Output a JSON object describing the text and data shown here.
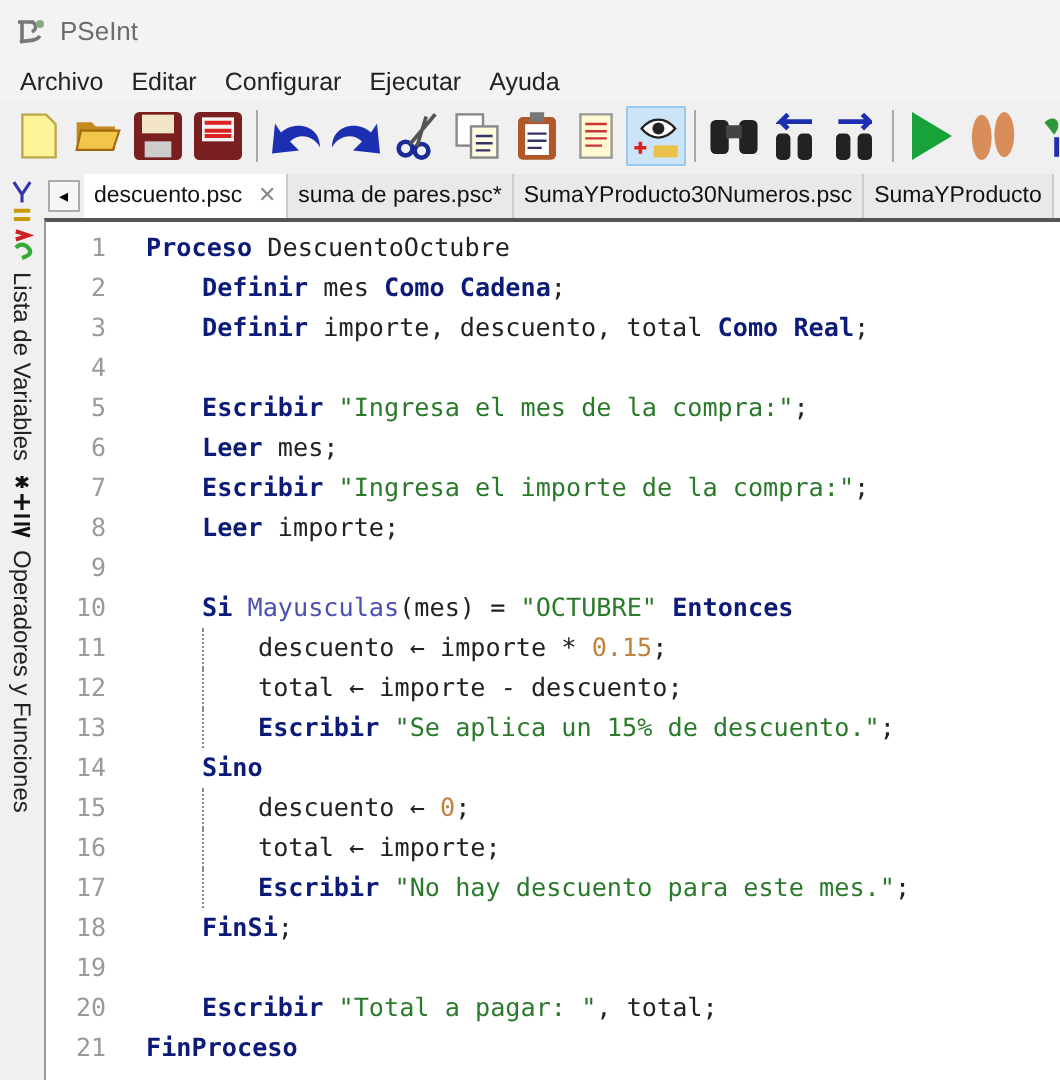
{
  "window": {
    "title": "PSeInt"
  },
  "menu": [
    "Archivo",
    "Editar",
    "Configurar",
    "Ejecutar",
    "Ayuda"
  ],
  "toolbar": [
    [
      {
        "kind": "new"
      },
      {
        "kind": "open"
      },
      {
        "kind": "save"
      },
      {
        "kind": "saveas"
      }
    ],
    [
      {
        "kind": "undo"
      },
      {
        "kind": "redo"
      },
      {
        "kind": "cut"
      },
      {
        "kind": "copy"
      },
      {
        "kind": "paste"
      },
      {
        "kind": "doc"
      },
      {
        "kind": "eye",
        "pressed": true
      }
    ],
    [
      {
        "kind": "find"
      },
      {
        "kind": "findprev"
      },
      {
        "kind": "findnext"
      }
    ],
    [
      {
        "kind": "run"
      },
      {
        "kind": "steps"
      },
      {
        "kind": "flow"
      }
    ]
  ],
  "tab_scroll": "◂",
  "tabs": [
    {
      "label": "descuento.psc",
      "selected": true,
      "close": "✕"
    },
    {
      "label": "suma de pares.psc*",
      "selected": false
    },
    {
      "label": "SumaYProducto30Numeros.psc",
      "selected": false
    },
    {
      "label": "SumaYProducto",
      "selected": false
    }
  ],
  "side_panels": [
    {
      "label": "Lista de Variables",
      "kind": "vars"
    },
    {
      "label": "Operadores y Funciones",
      "kind": "ops"
    }
  ],
  "code": [
    {
      "number": "1",
      "tokens": [
        {
          "kind": "kw",
          "text": "Proceso"
        },
        {
          "kind": "id",
          "text": " DescuentoOctubre"
        }
      ],
      "children": [
        {
          "number": "2",
          "tokens": [
            {
              "kind": "kw",
              "text": "Definir"
            },
            {
              "kind": "id",
              "text": " mes "
            },
            {
              "kind": "kw",
              "text": "Como Cadena"
            },
            {
              "kind": "id",
              "text": ";"
            }
          ]
        },
        {
          "number": "3",
          "tokens": [
            {
              "kind": "kw",
              "text": "Definir"
            },
            {
              "kind": "id",
              "text": " importe, descuento, total "
            },
            {
              "kind": "kw",
              "text": "Como Real"
            },
            {
              "kind": "id",
              "text": ";"
            }
          ]
        },
        {
          "number": "4"
        },
        {
          "number": "5",
          "tokens": [
            {
              "kind": "kw",
              "text": "Escribir"
            },
            {
              "kind": "str",
              "text": " \"Ingresa el mes de la compra:\""
            },
            {
              "kind": "id",
              "text": ";"
            }
          ]
        },
        {
          "number": "6",
          "tokens": [
            {
              "kind": "kw",
              "text": "Leer"
            },
            {
              "kind": "id",
              "text": " mes;"
            }
          ]
        },
        {
          "number": "7",
          "tokens": [
            {
              "kind": "kw",
              "text": "Escribir"
            },
            {
              "kind": "str",
              "text": " \"Ingresa el importe de la compra:\""
            },
            {
              "kind": "id",
              "text": ";"
            }
          ]
        },
        {
          "number": "8",
          "tokens": [
            {
              "kind": "kw",
              "text": "Leer"
            },
            {
              "kind": "id",
              "text": " importe;"
            }
          ]
        },
        {
          "number": "9"
        },
        {
          "number": "10",
          "tokens": [
            {
              "kind": "kw",
              "text": "Si"
            },
            {
              "kind": "fn",
              "text": " Mayusculas"
            },
            {
              "kind": "id",
              "text": "(mes) = "
            },
            {
              "kind": "str",
              "text": "\"OCTUBRE\""
            },
            {
              "kind": "kw",
              "text": " Entonces"
            }
          ],
          "children": [
            {
              "number": "11",
              "tokens": [
                {
                  "kind": "id",
                  "text": "descuento ← importe * "
                },
                {
                  "kind": "num",
                  "text": "0.15"
                },
                {
                  "kind": "id",
                  "text": ";"
                }
              ]
            },
            {
              "number": "12",
              "tokens": [
                {
                  "kind": "id",
                  "text": "total ← importe - descuento;"
                }
              ]
            },
            {
              "number": "13",
              "tokens": [
                {
                  "kind": "kw",
                  "text": "Escribir"
                },
                {
                  "kind": "str",
                  "text": " \"Se aplica un 15% de descuento.\""
                },
                {
                  "kind": "id",
                  "text": ";"
                }
              ]
            }
          ]
        },
        {
          "number": "14",
          "tokens": [
            {
              "kind": "kw",
              "text": "Sino"
            }
          ],
          "children": [
            {
              "number": "15",
              "tokens": [
                {
                  "kind": "id",
                  "text": "descuento ← "
                },
                {
                  "kind": "num",
                  "text": "0"
                },
                {
                  "kind": "id",
                  "text": ";"
                }
              ]
            },
            {
              "number": "16",
              "tokens": [
                {
                  "kind": "id",
                  "text": "total ← importe;"
                }
              ]
            },
            {
              "number": "17",
              "tokens": [
                {
                  "kind": "kw",
                  "text": "Escribir"
                },
                {
                  "kind": "str",
                  "text": " \"No hay descuento para este mes.\""
                },
                {
                  "kind": "id",
                  "text": ";"
                }
              ]
            }
          ]
        },
        {
          "number": "18",
          "tokens": [
            {
              "kind": "kw",
              "text": "FinSi"
            },
            {
              "kind": "id",
              "text": ";"
            }
          ]
        },
        {
          "number": "19"
        },
        {
          "number": "20",
          "tokens": [
            {
              "kind": "kw",
              "text": "Escribir"
            },
            {
              "kind": "str",
              "text": " \"Total a pagar: \""
            },
            {
              "kind": "id",
              "text": ", total;"
            }
          ]
        }
      ]
    },
    {
      "number": "21",
      "tokens": [
        {
          "kind": "kw",
          "text": "FinProceso"
        }
      ]
    }
  ]
}
